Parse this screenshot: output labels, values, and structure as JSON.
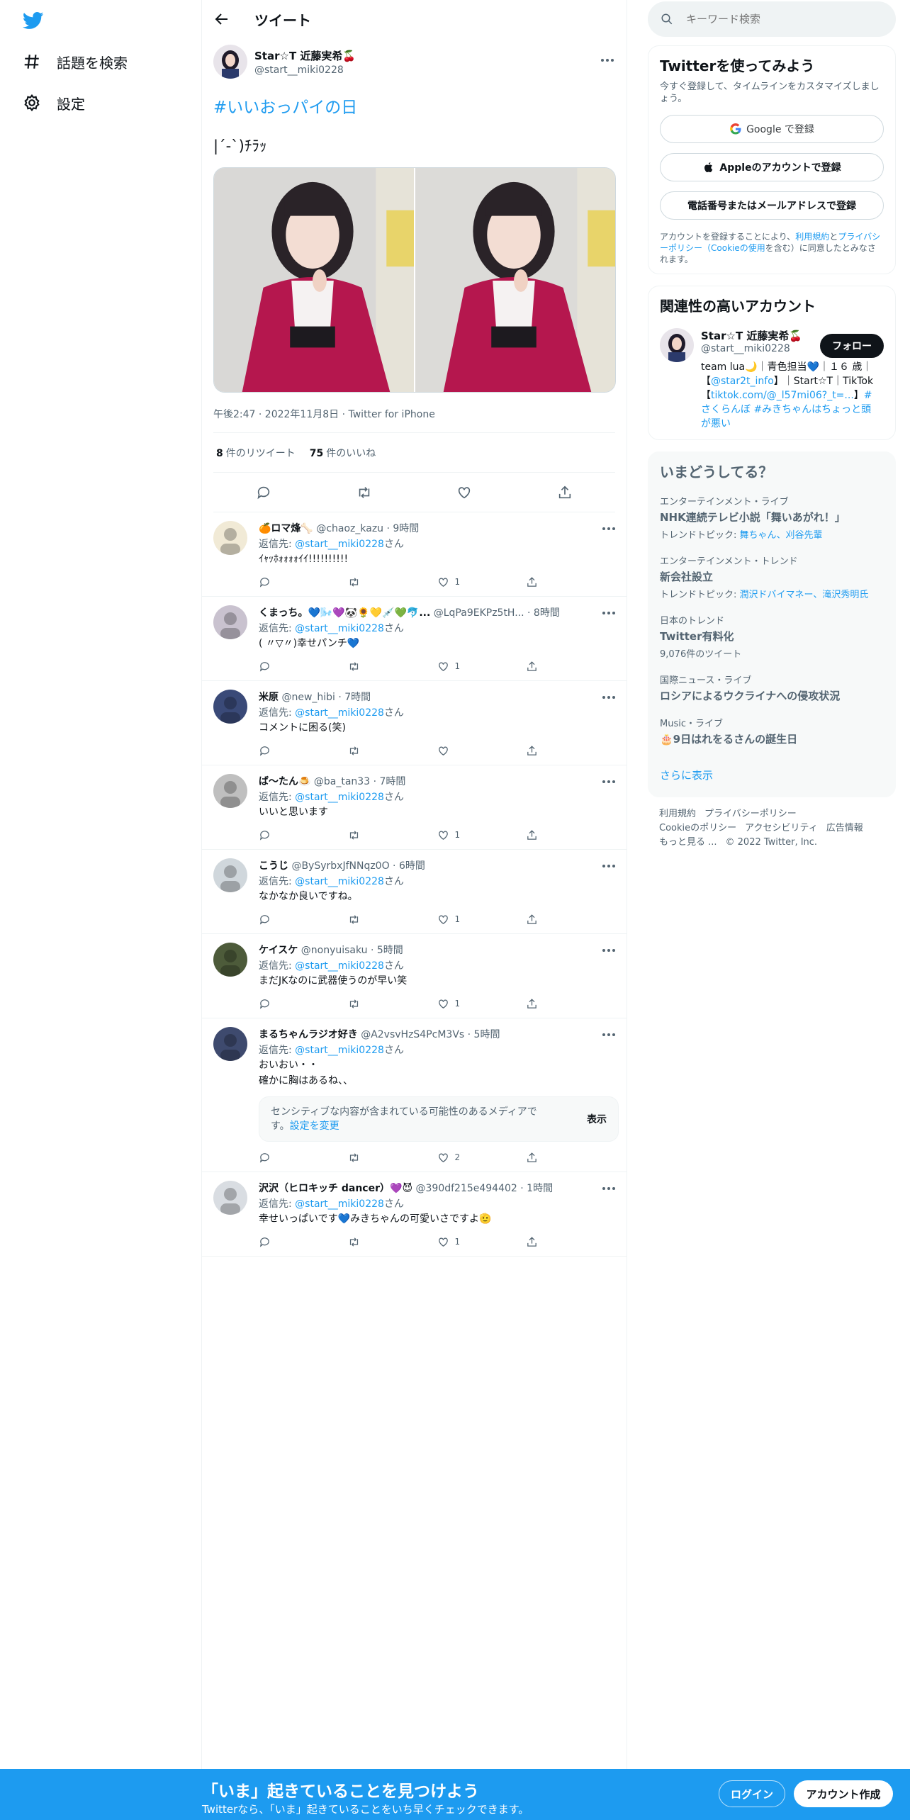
{
  "nav": {
    "explore_label": "話題を検索",
    "settings_label": "設定"
  },
  "header": {
    "title": "ツイート"
  },
  "tweet": {
    "author_name": "Star☆T 近藤実希🍒",
    "author_handle": "@start__miki0228",
    "hashtag": "#いいおっパイの日",
    "text": "|´-`)ﾁﾗｯ",
    "meta": "午後2:47 · 2022年11月8日 · Twitter for iPhone",
    "retweets_count": "8",
    "retweets_label": "件のリツイート",
    "likes_count": "75",
    "likes_label": "件のいいね"
  },
  "replies": [
    {
      "name": "🍊ロマ烽🦴",
      "handle": "@chaoz_kazu · 9時間",
      "reply_to_prefix": "返信先: ",
      "reply_to": "@start__miki0228",
      "reply_to_suffix": "さん",
      "text": "ｲｬｯﾎｫｫｫｫｲｲ!!!!!!!!!!",
      "likes": "1"
    },
    {
      "name": "くまっち。💙🌬️💜🐼🌻💛💉💚🐬...",
      "handle": "@LqPa9EKPz5tH... · 8時間",
      "reply_to_prefix": "返信先: ",
      "reply_to": "@start__miki0228",
      "reply_to_suffix": "さん",
      "text": "( 〃▽〃)幸せパンチ💙",
      "likes": "1"
    },
    {
      "name": "米原",
      "handle": "@new_hibi · 7時間",
      "reply_to_prefix": "返信先: ",
      "reply_to": "@start__miki0228",
      "reply_to_suffix": "さん",
      "text": "コメントに困る(笑)",
      "likes": ""
    },
    {
      "name": "ば〜たん🍮",
      "handle": "@ba_tan33 · 7時間",
      "reply_to_prefix": "返信先: ",
      "reply_to": "@start__miki0228",
      "reply_to_suffix": "さん",
      "text": "いいと思います",
      "likes": "1"
    },
    {
      "name": "こうじ",
      "handle": "@BySyrbxJfNNqz0O · 6時間",
      "reply_to_prefix": "返信先: ",
      "reply_to": "@start__miki0228",
      "reply_to_suffix": "さん",
      "text": "なかなか良いですね。",
      "likes": "1"
    },
    {
      "name": "ケイスケ",
      "handle": "@nonyuisaku · 5時間",
      "reply_to_prefix": "返信先: ",
      "reply_to": "@start__miki0228",
      "reply_to_suffix": "さん",
      "text": "まだJKなのに武器使うのが早い笑",
      "likes": "1"
    },
    {
      "name": "まるちゃんラジオ好き",
      "handle": "@A2vsvHzS4PcM3Vs · 5時間",
      "reply_to_prefix": "返信先: ",
      "reply_to": "@start__miki0228",
      "reply_to_suffix": "さん",
      "text": "おいおい・・",
      "text2": "確かに胸はあるね、、",
      "likes": "2",
      "sensitive_text": "センシティブな内容が含まれている可能性のあるメディアです。",
      "sensitive_link": "設定を変更",
      "sensitive_button": "表示"
    },
    {
      "name": "沢沢（ヒロキッチ dancer）💜😈",
      "handle": "@390df215e494402 · 1時間",
      "reply_to_prefix": "返信先: ",
      "reply_to": "@start__miki0228",
      "reply_to_suffix": "さん",
      "text": "幸せいっぱいです💙みきちゃんの可愛いさですよ🫡",
      "likes": "1"
    }
  ],
  "search": {
    "placeholder": "キーワード検索"
  },
  "signup_card": {
    "title": "Twitterを使ってみよう",
    "subtitle": "今すぐ登録して、タイムラインをカスタマイズしましょう。",
    "google": "Google で登録",
    "apple": "Appleのアカウントで登録",
    "phone": "電話番号またはメールアドレスで登録",
    "legal_1": "アカウントを登録することにより、",
    "legal_link1": "利用規約",
    "legal_2": "と",
    "legal_link2": "プライバシーポリシー（Cookieの使用",
    "legal_3": "を含む）に同意したとみなされます。"
  },
  "related": {
    "title": "関連性の高いアカウント",
    "name": "Star☆T 近藤実希🍒",
    "handle": "@start__miki0228",
    "follow": "フォロー",
    "bio_1": "team lua🌙｜青色担当💙｜１６ 歳｜【",
    "bio_link1": "@star2t_info",
    "bio_2": "】｜Start☆T｜TikTok【",
    "bio_link2": "tiktok.com/@_l57mi06?_t=...",
    "bio_3": "】",
    "bio_link3": "#さくらんぼ #みきちゃんはちょっと頭が悪い"
  },
  "trends": {
    "title": "いまどうしてる？",
    "items": [
      {
        "category": "エンターテインメント・ライブ",
        "name": "NHK連続テレビ小説「舞いあがれ！」",
        "meta_prefix": "トレンドトピック: ",
        "meta_link": "舞ちゃん、刈谷先輩"
      },
      {
        "category": "エンターテインメント・トレンド",
        "name": "新会社設立",
        "meta_prefix": "トレンドトピック: ",
        "meta_link": "潤沢ドバイマネー、滝沢秀明氏"
      },
      {
        "category": "日本のトレンド",
        "name": "Twitter有料化",
        "meta_prefix": "9,076件のツイート",
        "meta_link": ""
      },
      {
        "category": "国際ニュース・ライブ",
        "name": "ロシアによるウクライナへの侵攻状況",
        "meta_prefix": "",
        "meta_link": ""
      },
      {
        "category": "Music・ライブ",
        "name": "🎂9日はれをるさんの誕生日",
        "meta_prefix": "",
        "meta_link": ""
      }
    ],
    "show_more": "さらに表示"
  },
  "footer": {
    "links": [
      "利用規約",
      "プライバシーポリシー",
      "Cookieのポリシー",
      "アクセシビリティ",
      "広告情報",
      "もっと見る ...",
      "© 2022 Twitter, Inc."
    ]
  },
  "bottom": {
    "headline": "「いま」起きていることを見つけよう",
    "sub": "Twitterなら、「いま」起きていることをいち早くチェックできます。",
    "login": "ログイン",
    "signup": "アカウント作成"
  },
  "colors": {
    "accent": "#1d9bf0",
    "text": "#0f1419",
    "muted": "#536471"
  }
}
